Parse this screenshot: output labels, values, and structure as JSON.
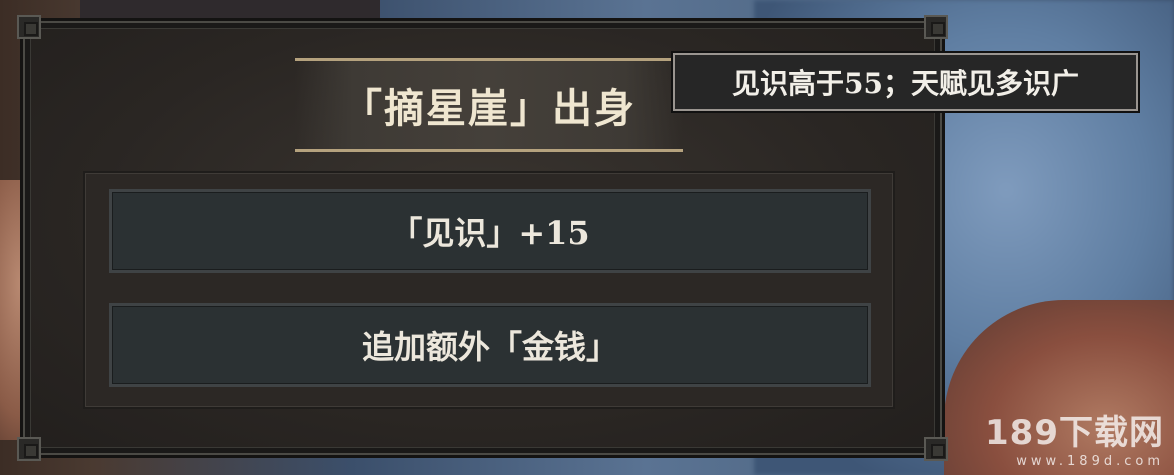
{
  "dialog": {
    "title": "「摘星崖」出身",
    "options": [
      {
        "label": "「见识」+15"
      },
      {
        "label": "追加额外「金钱」"
      }
    ]
  },
  "tooltip": {
    "text": "见识高于55；天赋见多识广"
  },
  "watermark": {
    "brand": "189下载网",
    "url": "www.189d.com"
  },
  "colors": {
    "dialog_bg": "#2a2623",
    "title_text": "#efe6d0",
    "title_border": "#b5a27e",
    "option_bg": "#2b3133",
    "option_text": "#ece7dc",
    "tooltip_bg": "#262626"
  }
}
